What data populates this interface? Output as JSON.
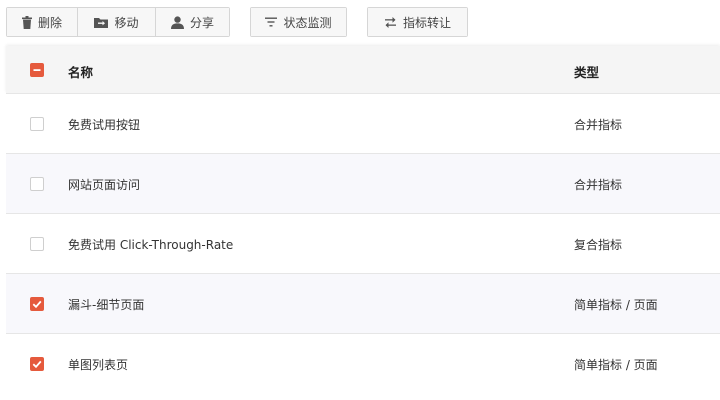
{
  "toolbar": {
    "delete_label": "删除",
    "move_label": "移动",
    "share_label": "分享",
    "status_monitor_label": "状态监测",
    "metric_transfer_label": "指标转让",
    "icons": [
      "trash-icon",
      "folder-icon",
      "user-icon",
      "filter-icon",
      "swap-arrows-icon"
    ]
  },
  "table": {
    "select_all_state": "partial",
    "headers": {
      "name": "名称",
      "type": "类型"
    },
    "rows": [
      {
        "name": "免费试用按钮",
        "type": "合并指标",
        "checked": false
      },
      {
        "name": "网站页面访问",
        "type": "合并指标",
        "checked": false
      },
      {
        "name": "免费试用 Click-Through-Rate",
        "type": "复合指标",
        "checked": false
      },
      {
        "name": "漏斗-细节页面",
        "type": "简单指标 / 页面",
        "checked": true
      },
      {
        "name": "单图列表页",
        "type": "简单指标 / 页面",
        "checked": true
      }
    ]
  },
  "colors": {
    "accent": "#e55a3d",
    "row_alt": "#f8f8fc",
    "header_bg": "#f5f5f5"
  }
}
